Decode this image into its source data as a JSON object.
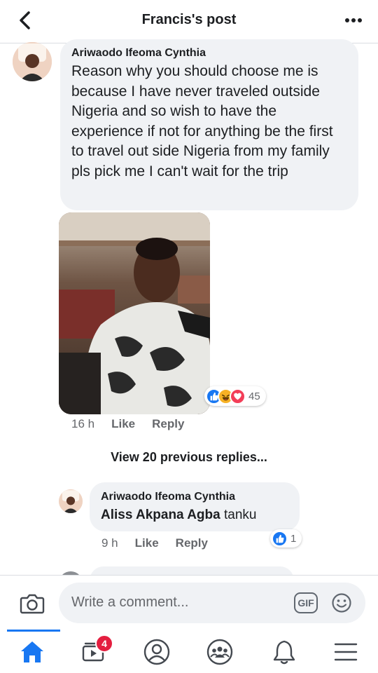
{
  "header": {
    "title": "Francis's post",
    "back_icon": "chevron-left-icon",
    "more_icon": "more-dots-icon"
  },
  "comment": {
    "author": "Ariwaodo Ifeoma Cynthia",
    "text": "Reason why you should choose me is because I have never traveled outside Nigeria and so wish to have the experience if not for anything be the first to travel out side Nigeria from my family pls pick me I can't wait for the trip",
    "photo": "selfie-photo",
    "reactions": {
      "icons": [
        "like-reaction-icon",
        "haha-reaction-icon",
        "love-reaction-icon"
      ],
      "count": "45"
    },
    "time": "16 h",
    "like_label": "Like",
    "reply_label": "Reply"
  },
  "view_previous": "View 20 previous replies...",
  "reply": {
    "author": "Ariwaodo Ifeoma Cynthia",
    "mention": "Aliss Akpana Agba",
    "text": "tanku",
    "time": "9 h",
    "like_label": "Like",
    "reply_label": "Reply",
    "reaction_count": "1"
  },
  "composer": {
    "placeholder": "Write a comment...",
    "gif_label": "GIF"
  },
  "nav": {
    "items": [
      "home-icon",
      "video-icon",
      "profile-icon",
      "groups-icon",
      "bell-icon",
      "menu-icon"
    ],
    "video_badge": "4"
  },
  "colors": {
    "accent": "#1877f2",
    "bubble": "#f0f2f5",
    "secondary_text": "#65676b",
    "badge": "#e41e3f",
    "love": "#f33e58",
    "haha": "#f7b125"
  }
}
